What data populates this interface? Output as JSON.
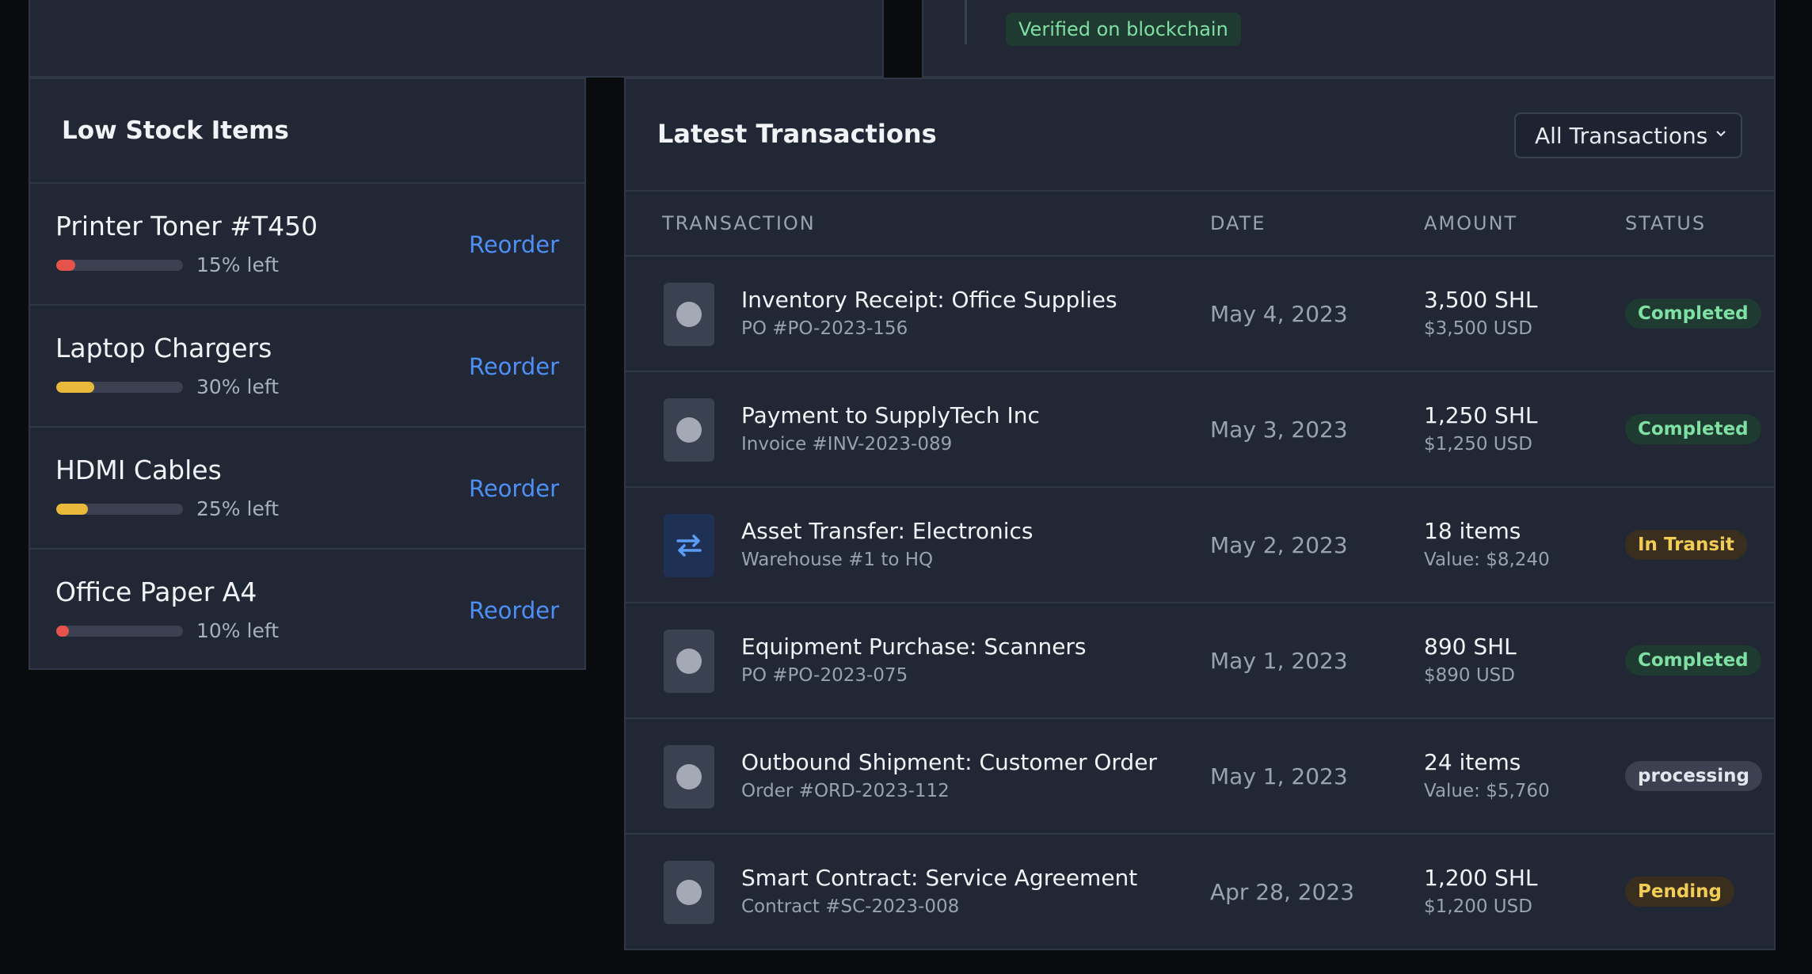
{
  "top": {
    "verified_label": "Verified on blockchain"
  },
  "low_stock": {
    "title": "Low Stock Items",
    "reorder_label": "Reorder",
    "items": [
      {
        "name": "Printer Toner #T450",
        "pct_label": "15% left",
        "fill_pct": 15,
        "color": "#e5534b"
      },
      {
        "name": "Laptop Chargers",
        "pct_label": "30% left",
        "fill_pct": 30,
        "color": "#e8b93a"
      },
      {
        "name": "HDMI Cables",
        "pct_label": "25% left",
        "fill_pct": 25,
        "color": "#e8b93a"
      },
      {
        "name": "Office Paper A4",
        "pct_label": "10% left",
        "fill_pct": 10,
        "color": "#e5534b"
      }
    ]
  },
  "transactions": {
    "title": "Latest Transactions",
    "filter_selected": "All Transactions",
    "columns": {
      "transaction": "TRANSACTION",
      "date": "DATE",
      "amount": "AMOUNT",
      "status": "STATUS"
    },
    "rows": [
      {
        "icon": "circle-icon",
        "name": "Inventory Receipt: Office Supplies",
        "sub": "PO #PO-2023-156",
        "date": "May 4, 2023",
        "amount": "3,500 SHL",
        "amount_sub": "$3,500 USD",
        "status": "Completed",
        "status_kind": "completed"
      },
      {
        "icon": "circle-icon",
        "name": "Payment to SupplyTech Inc",
        "sub": "Invoice #INV-2023-089",
        "date": "May 3, 2023",
        "amount": "1,250 SHL",
        "amount_sub": "$1,250 USD",
        "status": "Completed",
        "status_kind": "completed"
      },
      {
        "icon": "transfer-arrows-icon",
        "name": "Asset Transfer: Electronics",
        "sub": "Warehouse #1 to HQ",
        "date": "May 2, 2023",
        "amount": "18 items",
        "amount_sub": "Value: $8,240",
        "status": "In Transit",
        "status_kind": "transit"
      },
      {
        "icon": "circle-icon",
        "name": "Equipment Purchase: Scanners",
        "sub": "PO #PO-2023-075",
        "date": "May 1, 2023",
        "amount": "890 SHL",
        "amount_sub": "$890 USD",
        "status": "Completed",
        "status_kind": "completed"
      },
      {
        "icon": "circle-icon",
        "name": "Outbound Shipment: Customer Order",
        "sub": "Order #ORD-2023-112",
        "date": "May 1, 2023",
        "amount": "24 items",
        "amount_sub": "Value: $5,760",
        "status": "processing",
        "status_kind": "processing"
      },
      {
        "icon": "circle-icon",
        "name": "Smart Contract: Service Agreement",
        "sub": "Contract #SC-2023-008",
        "date": "Apr 28, 2023",
        "amount": "1,200 SHL",
        "amount_sub": "$1,200 USD",
        "status": "Pending",
        "status_kind": "pending"
      }
    ]
  }
}
